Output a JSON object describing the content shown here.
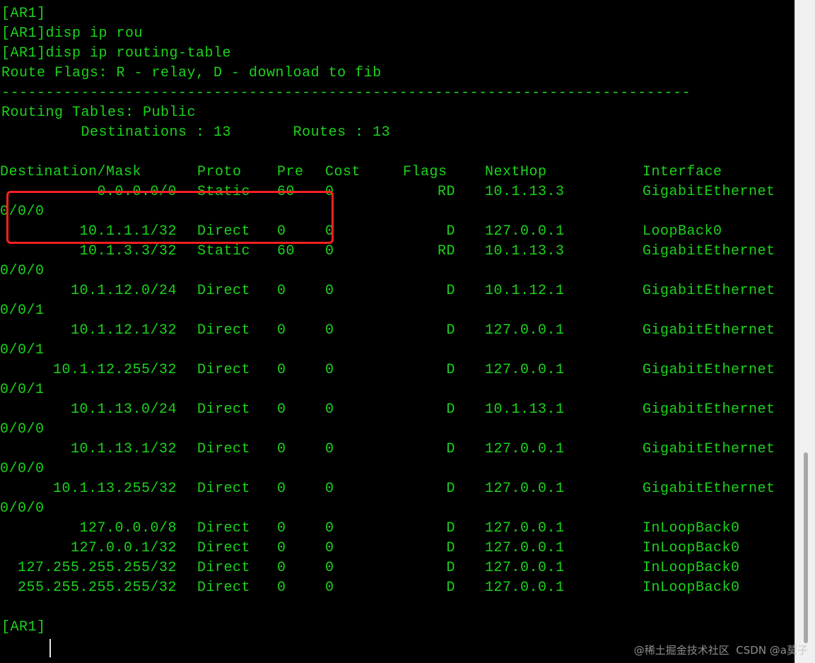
{
  "colors": {
    "text": "#1bd31b",
    "background": "#000000",
    "highlight": "#ff2020"
  },
  "header_lines": [
    "[AR1]",
    "[AR1]disp ip rou",
    "[AR1]disp ip routing-table",
    "Route Flags: R - relay, D - download to fib",
    "------------------------------------------------------------------------------",
    "Routing Tables: Public",
    "         Destinations : 13       Routes : 13"
  ],
  "table": {
    "headers": {
      "destination": "Destination/Mask",
      "proto": "Proto",
      "pre": "Pre",
      "cost": "Cost",
      "flags": "Flags",
      "nexthop": "NextHop",
      "interface": "Interface"
    },
    "rows": [
      {
        "destination": "0.0.0.0/0",
        "proto": "Static",
        "pre": "60",
        "cost": "0",
        "flags": "RD",
        "nexthop": "10.1.13.3",
        "interface": "GigabitEthernet",
        "interface_cont": "0/0/0"
      },
      {
        "destination": "10.1.1.1/32",
        "proto": "Direct",
        "pre": "0",
        "cost": "0",
        "flags": "D",
        "nexthop": "127.0.0.1",
        "interface": "LoopBack0",
        "interface_cont": ""
      },
      {
        "destination": "10.1.3.3/32",
        "proto": "Static",
        "pre": "60",
        "cost": "0",
        "flags": "RD",
        "nexthop": "10.1.13.3",
        "interface": "GigabitEthernet",
        "interface_cont": "0/0/0"
      },
      {
        "destination": "10.1.12.0/24",
        "proto": "Direct",
        "pre": "0",
        "cost": "0",
        "flags": "D",
        "nexthop": "10.1.12.1",
        "interface": "GigabitEthernet",
        "interface_cont": "0/0/1"
      },
      {
        "destination": "10.1.12.1/32",
        "proto": "Direct",
        "pre": "0",
        "cost": "0",
        "flags": "D",
        "nexthop": "127.0.0.1",
        "interface": "GigabitEthernet",
        "interface_cont": "0/0/1"
      },
      {
        "destination": "10.1.12.255/32",
        "proto": "Direct",
        "pre": "0",
        "cost": "0",
        "flags": "D",
        "nexthop": "127.0.0.1",
        "interface": "GigabitEthernet",
        "interface_cont": "0/0/1"
      },
      {
        "destination": "10.1.13.0/24",
        "proto": "Direct",
        "pre": "0",
        "cost": "0",
        "flags": "D",
        "nexthop": "10.1.13.1",
        "interface": "GigabitEthernet",
        "interface_cont": "0/0/0"
      },
      {
        "destination": "10.1.13.1/32",
        "proto": "Direct",
        "pre": "0",
        "cost": "0",
        "flags": "D",
        "nexthop": "127.0.0.1",
        "interface": "GigabitEthernet",
        "interface_cont": "0/0/0"
      },
      {
        "destination": "10.1.13.255/32",
        "proto": "Direct",
        "pre": "0",
        "cost": "0",
        "flags": "D",
        "nexthop": "127.0.0.1",
        "interface": "GigabitEthernet",
        "interface_cont": "0/0/0"
      },
      {
        "destination": "127.0.0.0/8",
        "proto": "Direct",
        "pre": "0",
        "cost": "0",
        "flags": "D",
        "nexthop": "127.0.0.1",
        "interface": "InLoopBack0",
        "interface_cont": ""
      },
      {
        "destination": "127.0.0.1/32",
        "proto": "Direct",
        "pre": "0",
        "cost": "0",
        "flags": "D",
        "nexthop": "127.0.0.1",
        "interface": "InLoopBack0",
        "interface_cont": ""
      },
      {
        "destination": "127.255.255.255/32",
        "proto": "Direct",
        "pre": "0",
        "cost": "0",
        "flags": "D",
        "nexthop": "127.0.0.1",
        "interface": "InLoopBack0",
        "interface_cont": ""
      },
      {
        "destination": "255.255.255.255/32",
        "proto": "Direct",
        "pre": "0",
        "cost": "0",
        "flags": "D",
        "nexthop": "127.0.0.1",
        "interface": "InLoopBack0",
        "interface_cont": ""
      }
    ]
  },
  "prompt": "[AR1]",
  "watermark": "@稀土掘金技术社区  CSDN @a莫子"
}
